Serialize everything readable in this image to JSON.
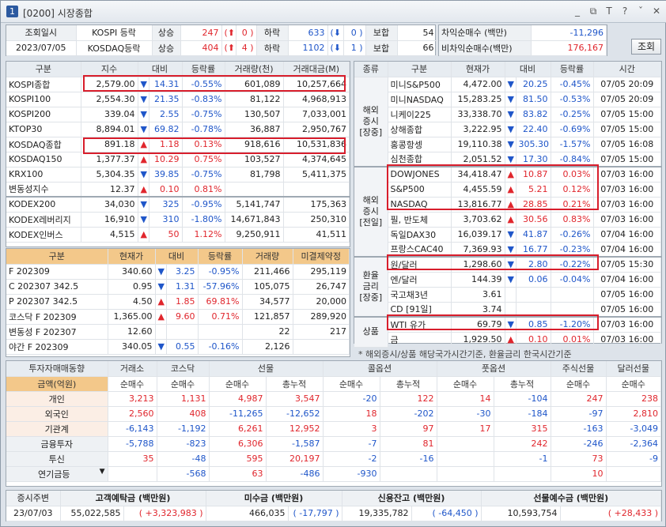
{
  "title": {
    "code": "[0200]",
    "name": "시장종합",
    "num": "1"
  },
  "titleIcons": [
    "_",
    "⧉",
    "T",
    "?",
    "ˇ",
    "✕"
  ],
  "top": {
    "label1": "조회일시",
    "date": "2023/07/05",
    "k1": "KOSPI 등락",
    "k2": "KOSDAQ등락",
    "up": "상승",
    "down": "하락",
    "flat": "보합",
    "kospi": {
      "up": "247",
      "upLimit": "0",
      "down": "633",
      "downLimit": "0",
      "flat": "54"
    },
    "kosdaq": {
      "up": "404",
      "upLimit": "4",
      "down": "1102",
      "downLimit": "1",
      "flat": "66"
    },
    "arb": "차익순매수",
    "narb": "비차익순매수",
    "unit": "(백만)",
    "arbVal": "-11,296",
    "narbVal": "176,167",
    "query": "조회"
  },
  "idx": {
    "headers": [
      "구분",
      "지수",
      "대비",
      "등락률",
      "거래량(천)",
      "거래대금(M)"
    ],
    "rows": [
      [
        "KOSPI종합",
        "2,579.00",
        "dn",
        "14.31",
        "-0.55%",
        "601,089",
        "10,257,664"
      ],
      [
        "KOSPI100",
        "2,554.30",
        "dn",
        "21.35",
        "-0.83%",
        "81,122",
        "4,968,913"
      ],
      [
        "KOSPI200",
        "339.04",
        "dn",
        "2.55",
        "-0.75%",
        "130,507",
        "7,033,001"
      ],
      [
        "KTOP30",
        "8,894.01",
        "dn",
        "69.82",
        "-0.78%",
        "36,887",
        "2,950,767"
      ],
      [
        "KOSDAQ종합",
        "891.18",
        "up",
        "1.18",
        "0.13%",
        "918,616",
        "10,531,836"
      ],
      [
        "KOSDAQ150",
        "1,377.37",
        "up",
        "10.29",
        "0.75%",
        "103,527",
        "4,374,645"
      ],
      [
        "KRX100",
        "5,304.35",
        "dn",
        "39.85",
        "-0.75%",
        "81,798",
        "5,411,375"
      ],
      [
        "변동성지수",
        "12.37",
        "up",
        "0.10",
        "0.81%",
        "",
        ""
      ]
    ],
    "etf": [
      [
        "KODEX200",
        "34,030",
        "dn",
        "325",
        "-0.95%",
        "5,141,747",
        "175,363"
      ],
      [
        "KODEX레버리지",
        "16,910",
        "dn",
        "310",
        "-1.80%",
        "14,671,843",
        "250,310"
      ],
      [
        "KODEX인버스",
        "4,515",
        "up",
        "50",
        "1.12%",
        "9,250,911",
        "41,511"
      ]
    ]
  },
  "fut": {
    "headers": [
      "구분",
      "현재가",
      "대비",
      "등락률",
      "거래량",
      "미결제약정"
    ],
    "rows": [
      [
        "F 202309",
        "340.60",
        "dn",
        "3.25",
        "-0.95%",
        "211,466",
        "295,119"
      ],
      [
        "C 202307 342.5",
        "0.95",
        "dn",
        "1.31",
        "-57.96%",
        "105,075",
        "26,747"
      ],
      [
        "P 202307 342.5",
        "4.50",
        "up",
        "1.85",
        "69.81%",
        "34,577",
        "20,000"
      ],
      [
        "코스닥 F 202309",
        "1,365.00",
        "up",
        "9.60",
        "0.71%",
        "121,857",
        "289,920"
      ],
      [
        "변동성 F 202307",
        "12.60",
        "",
        "",
        "",
        "22",
        "217"
      ],
      [
        "야간 F 202309",
        "340.05",
        "dn",
        "0.55",
        "-0.16%",
        "2,126",
        ""
      ]
    ]
  },
  "world": {
    "headers": [
      "종류",
      "구분",
      "현재가",
      "대비",
      "등락률",
      "시간"
    ],
    "groups": [
      {
        "name": "해외\n증시\n[장중]",
        "rows": [
          [
            "미니S&P500",
            "4,472.00",
            "dn",
            "20.25",
            "-0.45%",
            "07/05 20:09"
          ],
          [
            "미니NASDAQ",
            "15,283.25",
            "dn",
            "81.50",
            "-0.53%",
            "07/05 20:09"
          ],
          [
            "니케이225",
            "33,338.70",
            "dn",
            "83.82",
            "-0.25%",
            "07/05 15:00"
          ],
          [
            "상해종합",
            "3,222.95",
            "dn",
            "22.40",
            "-0.69%",
            "07/05 15:00"
          ],
          [
            "홍콩항셍",
            "19,110.38",
            "dn",
            "305.30",
            "-1.57%",
            "07/05 16:08"
          ],
          [
            "심천종합",
            "2,051.52",
            "dn",
            "17.30",
            "-0.84%",
            "07/05 15:00"
          ]
        ]
      },
      {
        "name": "해외\n증시\n[전일]",
        "rows": [
          [
            "DOWJONES",
            "34,418.47",
            "up",
            "10.87",
            "0.03%",
            "07/03 16:00"
          ],
          [
            "S&P500",
            "4,455.59",
            "up",
            "5.21",
            "0.12%",
            "07/03 16:00"
          ],
          [
            "NASDAQ",
            "13,816.77",
            "up",
            "28.85",
            "0.21%",
            "07/03 16:00"
          ],
          [
            "필, 반도체",
            "3,703.62",
            "up",
            "30.56",
            "0.83%",
            "07/03 16:00"
          ],
          [
            "독일DAX30",
            "16,039.17",
            "dn",
            "41.87",
            "-0.26%",
            "07/04 16:00"
          ],
          [
            "프랑스CAC40",
            "7,369.93",
            "dn",
            "16.77",
            "-0.23%",
            "07/04 16:00"
          ]
        ]
      },
      {
        "name": "환율\n금리\n[장중]",
        "rows": [
          [
            "원/달러",
            "1,298.60",
            "dn",
            "2.80",
            "-0.22%",
            "07/05 15:30"
          ],
          [
            "엔/달러",
            "144.39",
            "dn",
            "0.06",
            "-0.04%",
            "07/04 16:00"
          ],
          [
            "국고채3년",
            "3.61",
            "",
            "",
            "",
            "07/05 16:00"
          ],
          [
            "CD [91일]",
            "3.74",
            "",
            "",
            "",
            "07/05 16:00"
          ]
        ]
      },
      {
        "name": "상품",
        "rows": [
          [
            "WTI 유가",
            "69.79",
            "dn",
            "0.85",
            "-1.20%",
            "07/03 16:00"
          ],
          [
            "금",
            "1,929.50",
            "up",
            "0.10",
            "0.01%",
            "07/03 16:00"
          ]
        ]
      }
    ],
    "note": "* 해외증시/상품 해당국가시간기준, 환율금리 한국시간기준"
  },
  "inv": {
    "title": "투자자매매동향",
    "unit": "금액(억원)",
    "cols": [
      "거래소",
      "코스닥",
      "선물",
      "콜옵션",
      "풋옵션",
      "주식선물",
      "달러선물"
    ],
    "sub": [
      "순매수",
      "순매수",
      "순매수",
      "총누적",
      "순매수",
      "총누적",
      "순매수",
      "총누적",
      "순매수",
      "순매수"
    ],
    "rows": [
      [
        "개인",
        "3,213",
        "1,131",
        "4,987",
        "3,547",
        "-20",
        "122",
        "14",
        "-104",
        "247",
        "238"
      ],
      [
        "외국인",
        "2,560",
        "408",
        "-11,265",
        "-12,652",
        "18",
        "-202",
        "-30",
        "-184",
        "-97",
        "2,810"
      ],
      [
        "기관계",
        "-6,143",
        "-1,192",
        "6,261",
        "12,952",
        "3",
        "97",
        "17",
        "315",
        "-163",
        "-3,049"
      ],
      [
        "금융투자",
        "-5,788",
        "-823",
        "6,306",
        "-1,587",
        "-7",
        "81",
        "",
        "242",
        "-246",
        "-2,364"
      ],
      [
        "투신",
        "35",
        "-48",
        "595",
        "20,197",
        "-2",
        "-16",
        "",
        "-1",
        "73",
        "-9"
      ],
      [
        "연기금등",
        "",
        "-568",
        "63",
        "-486",
        "-930",
        "",
        "",
        "",
        "10",
        ""
      ]
    ]
  },
  "bottom": {
    "l1": "증시주변",
    "date": "23/07/03",
    "items": [
      {
        "label": "고객예탁금 (백만원)",
        "val": "55,022,585",
        "chg": "+3,323,983",
        "dir": "up"
      },
      {
        "label": "미수금 (백만원)",
        "val": "466,035",
        "chg": "-17,797",
        "dir": "dn"
      },
      {
        "label": "신용잔고 (백만원)",
        "val": "19,335,782",
        "chg": "-64,450",
        "dir": "dn"
      },
      {
        "label": "선물예수금 (백만원)",
        "val": "10,593,754",
        "chg": "+28,433",
        "dir": "up"
      }
    ]
  }
}
